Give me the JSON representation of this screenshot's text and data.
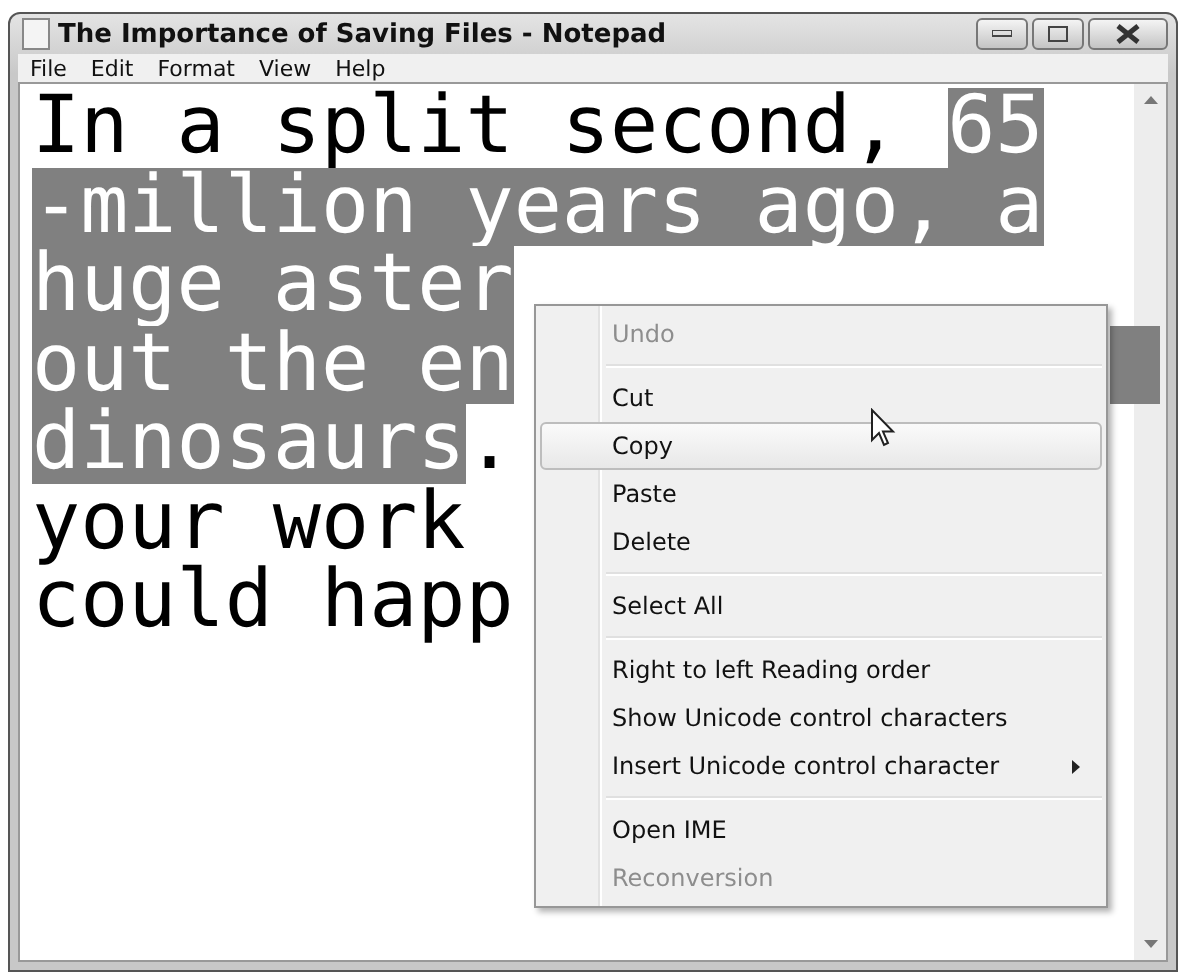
{
  "window": {
    "title": "The Importance of Saving Files - Notepad"
  },
  "menu_bar": [
    "File",
    "Edit",
    "Format",
    "View",
    "Help"
  ],
  "document": {
    "lines": [
      {
        "segments": [
          {
            "text": "In a split second, ",
            "selected": false
          },
          {
            "text": "65",
            "selected": true
          }
        ],
        "selection_extends": false
      },
      {
        "segments": [
          {
            "text": "-million years ago, a",
            "selected": true
          }
        ],
        "selection_extends": false
      },
      {
        "segments": [
          {
            "text": "huge aster",
            "selected": true
          }
        ],
        "selection_extends": false
      },
      {
        "segments": [
          {
            "text": "out the en",
            "selected": true
          }
        ],
        "selection_extends": true
      },
      {
        "segments": [
          {
            "text": "dinosaurs",
            "selected": true
          },
          {
            "text": ".",
            "selected": false
          }
        ],
        "selection_extends": false
      },
      {
        "segments": [
          {
            "text": "your work ",
            "selected": false
          }
        ],
        "selection_extends": false
      },
      {
        "segments": [
          {
            "text": "could happ",
            "selected": false
          }
        ],
        "selection_extends": false
      }
    ]
  },
  "context_menu": {
    "items": [
      {
        "kind": "item",
        "label": "Undo",
        "disabled": true,
        "selected": false,
        "submenu": false
      },
      {
        "kind": "separator"
      },
      {
        "kind": "item",
        "label": "Cut",
        "disabled": false,
        "selected": false,
        "submenu": false
      },
      {
        "kind": "item",
        "label": "Copy",
        "disabled": false,
        "selected": true,
        "submenu": false
      },
      {
        "kind": "item",
        "label": "Paste",
        "disabled": false,
        "selected": false,
        "submenu": false
      },
      {
        "kind": "item",
        "label": "Delete",
        "disabled": false,
        "selected": false,
        "submenu": false
      },
      {
        "kind": "separator"
      },
      {
        "kind": "item",
        "label": "Select All",
        "disabled": false,
        "selected": false,
        "submenu": false
      },
      {
        "kind": "separator"
      },
      {
        "kind": "item",
        "label": "Right to left Reading order",
        "disabled": false,
        "selected": false,
        "submenu": false
      },
      {
        "kind": "item",
        "label": "Show Unicode control characters",
        "disabled": false,
        "selected": false,
        "submenu": false
      },
      {
        "kind": "item",
        "label": "Insert Unicode control character",
        "disabled": false,
        "selected": false,
        "submenu": true
      },
      {
        "kind": "separator"
      },
      {
        "kind": "item",
        "label": "Open IME",
        "disabled": false,
        "selected": false,
        "submenu": false
      },
      {
        "kind": "item",
        "label": "Reconversion",
        "disabled": true,
        "selected": false,
        "submenu": false
      }
    ]
  }
}
